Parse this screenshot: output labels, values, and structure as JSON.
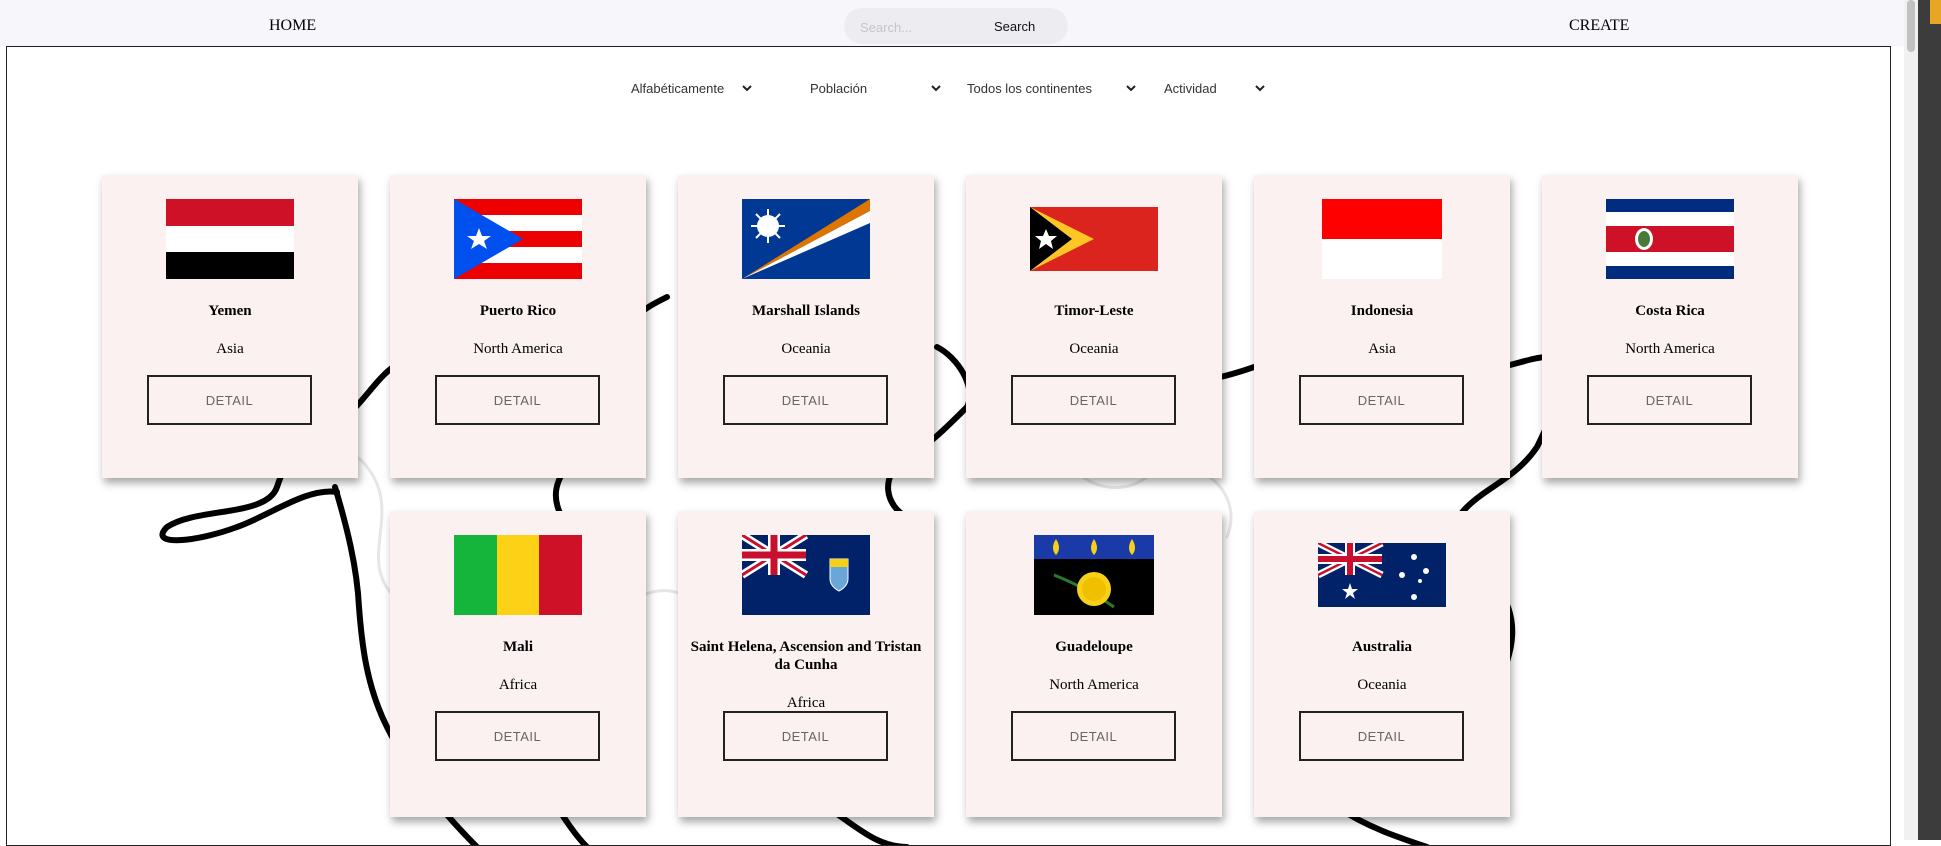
{
  "nav": {
    "home_label": "HOME",
    "create_label": "CREATE",
    "search_placeholder": "Search...",
    "search_button": "Search"
  },
  "filters": [
    {
      "label": "Alfabéticamente"
    },
    {
      "label": "Población"
    },
    {
      "label": "Todos los continentes"
    },
    {
      "label": "Actividad"
    }
  ],
  "countries": [
    {
      "name": "Yemen",
      "continent": "Asia",
      "detail": "DETAIL",
      "flag": "yemen-flag"
    },
    {
      "name": "Puerto Rico",
      "continent": "North America",
      "detail": "DETAIL",
      "flag": "puerto-rico-flag"
    },
    {
      "name": "Marshall Islands",
      "continent": "Oceania",
      "detail": "DETAIL",
      "flag": "marshall-islands-flag"
    },
    {
      "name": "Timor-Leste",
      "continent": "Oceania",
      "detail": "DETAIL",
      "flag": "timor-leste-flag"
    },
    {
      "name": "Indonesia",
      "continent": "Asia",
      "detail": "DETAIL",
      "flag": "indonesia-flag"
    },
    {
      "name": "Costa Rica",
      "continent": "North America",
      "detail": "DETAIL",
      "flag": "costa-rica-flag"
    },
    {
      "name": "Mali",
      "continent": "Africa",
      "detail": "DETAIL",
      "flag": "mali-flag"
    },
    {
      "name": "Saint Helena, Ascension and Tristan da Cunha",
      "continent": "Africa",
      "detail": "DETAIL",
      "flag": "saint-helena-flag"
    },
    {
      "name": "Guadeloupe",
      "continent": "North America",
      "detail": "DETAIL",
      "flag": "guadeloupe-flag"
    },
    {
      "name": "Australia",
      "continent": "Oceania",
      "detail": "DETAIL",
      "flag": "australia-flag"
    }
  ],
  "colors": {
    "card_bg": "#fbf1f0",
    "nav_bg": "#f6f6fb",
    "accent_corner": "#e7a623"
  }
}
